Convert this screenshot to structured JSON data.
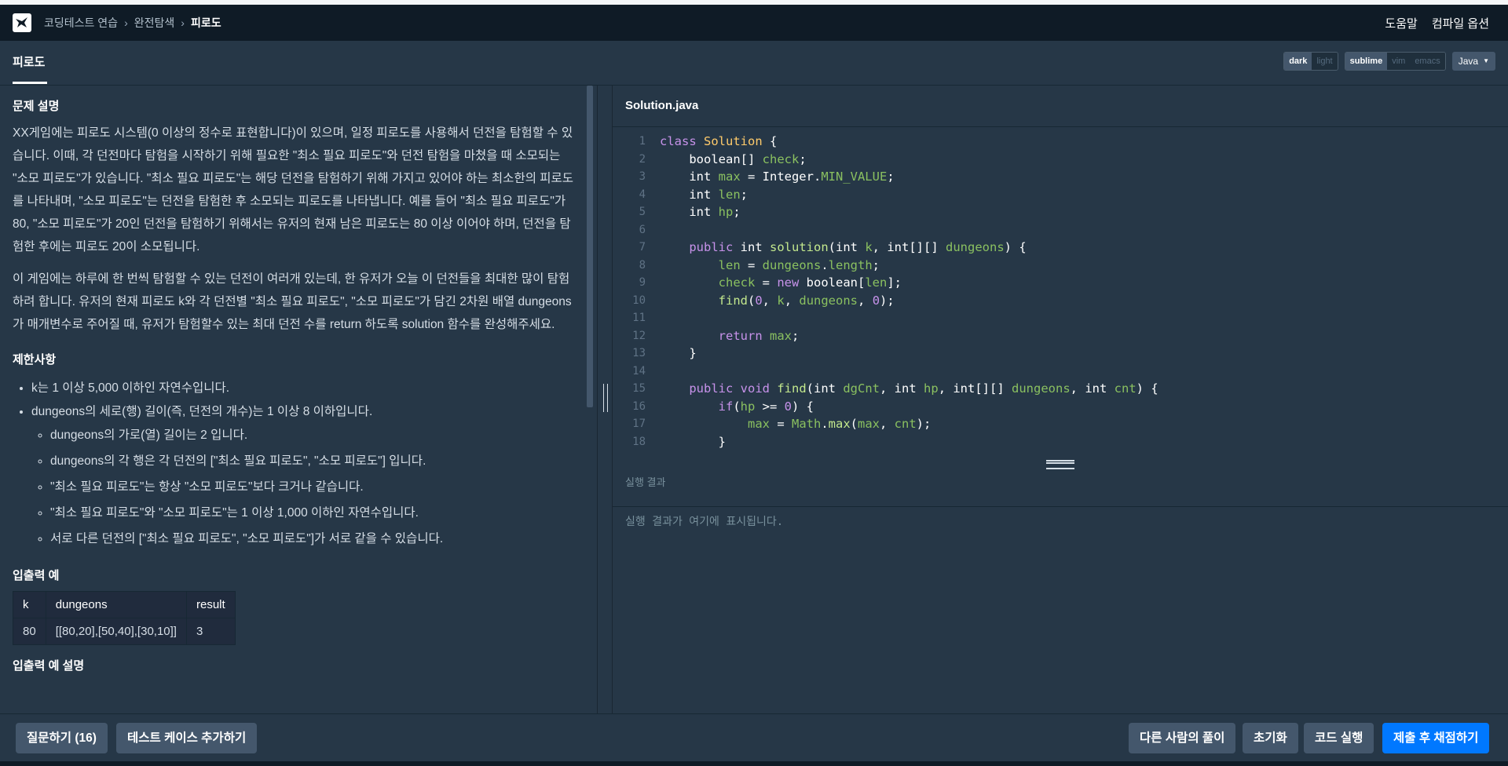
{
  "breadcrumb": [
    "코딩테스트 연습",
    "완전탐색",
    "피로도"
  ],
  "nav": {
    "help": "도움말",
    "compile_options": "컴파일 옵션"
  },
  "tab": {
    "title": "피로도"
  },
  "theme": {
    "dark": "dark",
    "light": "light"
  },
  "keymap": {
    "sublime": "sublime",
    "vim": "vim",
    "emacs": "emacs"
  },
  "language": "Java",
  "problem": {
    "section_title": "문제 설명",
    "para1": "XX게임에는 피로도 시스템(0 이상의 정수로 표현합니다)이 있으며, 일정 피로도를 사용해서 던전을 탐험할 수 있습니다. 이때, 각 던전마다 탐험을 시작하기 위해 필요한 \"최소 필요 피로도\"와 던전 탐험을 마쳤을 때 소모되는 \"소모 피로도\"가 있습니다. \"최소 필요 피로도\"는 해당 던전을 탐험하기 위해 가지고 있어야 하는 최소한의 피로도를 나타내며, \"소모 피로도\"는 던전을 탐험한 후 소모되는 피로도를 나타냅니다. 예를 들어 \"최소 필요 피로도\"가 80, \"소모 피로도\"가 20인 던전을 탐험하기 위해서는 유저의 현재 남은 피로도는 80 이상 이어야 하며, 던전을 탐험한 후에는 피로도 20이 소모됩니다.",
    "para2": "이 게임에는 하루에 한 번씩 탐험할 수 있는 던전이 여러개 있는데, 한 유저가 오늘 이 던전들을 최대한 많이 탐험하려 합니다. 유저의 현재 피로도 k와 각 던전별 \"최소 필요 피로도\", \"소모 피로도\"가 담긴 2차원 배열 dungeons 가 매개변수로 주어질 때, 유저가 탐험할수 있는 최대 던전 수를 return 하도록 solution 함수를 완성해주세요.",
    "constraints_title": "제한사항",
    "constraints": [
      "k는 1 이상 5,000 이하인 자연수입니다.",
      "dungeons의 세로(행) 길이(즉, 던전의 개수)는 1 이상 8 이하입니다."
    ],
    "sub_constraints": [
      "dungeons의 가로(열) 길이는 2 입니다.",
      "dungeons의 각 행은 각 던전의 [\"최소 필요 피로도\", \"소모 피로도\"] 입니다.",
      "\"최소 필요 피로도\"는 항상 \"소모 피로도\"보다 크거나 같습니다.",
      "\"최소 필요 피로도\"와 \"소모 피로도\"는 1 이상 1,000 이하인 자연수입니다.",
      "서로 다른 던전의 [\"최소 필요 피로도\", \"소모 피로도\"]가 서로 같을 수 있습니다."
    ],
    "io_title": "입출력 예",
    "io_headers": [
      "k",
      "dungeons",
      "result"
    ],
    "io_row": [
      "80",
      "[[80,20],[50,40],[30,10]]",
      "3"
    ],
    "io_explain_title": "입출력 예 설명"
  },
  "editor": {
    "filename": "Solution.java",
    "line_numbers": [
      "1",
      "2",
      "3",
      "4",
      "5",
      "6",
      "7",
      "8",
      "9",
      "10",
      "11",
      "12",
      "13",
      "14",
      "15",
      "16",
      "17",
      "18"
    ]
  },
  "result": {
    "title": "실행 결과",
    "placeholder": "실행 결과가 여기에 표시됩니다."
  },
  "buttons": {
    "ask": "질문하기 (16)",
    "add_testcase": "테스트 케이스 추가하기",
    "others_solution": "다른 사람의 풀이",
    "reset": "초기화",
    "run": "코드 실행",
    "submit": "제출 후 채점하기"
  }
}
